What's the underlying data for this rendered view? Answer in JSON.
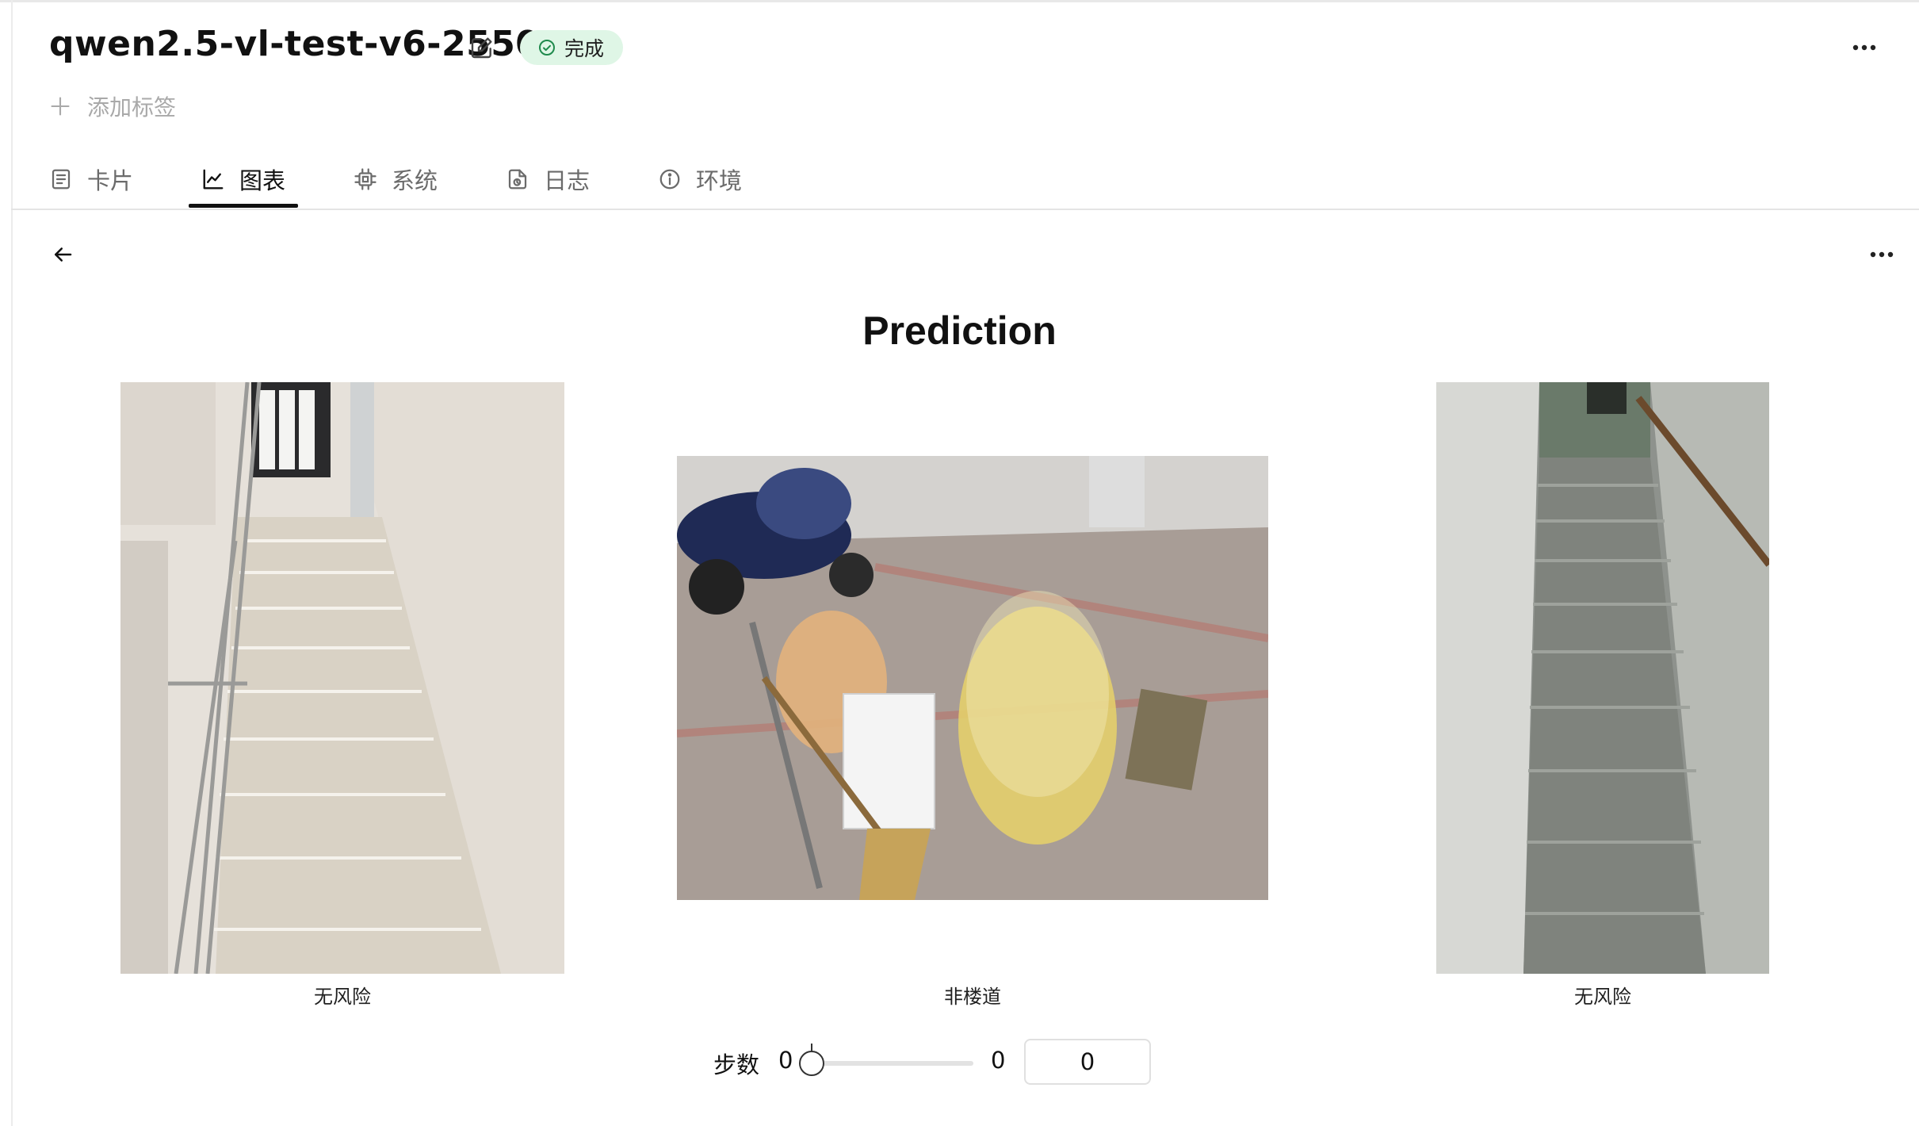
{
  "header": {
    "run_name": "qwen2.5-vl-test-v6-2550",
    "status": "完成",
    "add_tag_label": "添加标签"
  },
  "tabs": [
    {
      "label": "卡片",
      "icon": "card-icon"
    },
    {
      "label": "图表",
      "icon": "chart-line-icon",
      "active": true
    },
    {
      "label": "系统",
      "icon": "chip-icon"
    },
    {
      "label": "日志",
      "icon": "log-file-icon"
    },
    {
      "label": "环境",
      "icon": "info-icon"
    }
  ],
  "chart": {
    "title": "Prediction",
    "images": [
      {
        "caption": "无风险",
        "subject": "stairwell-with-steel-railing"
      },
      {
        "caption": "非楼道",
        "subject": "garbage-bags-and-broom-on-street"
      },
      {
        "caption": "无风险",
        "subject": "dim-concrete-stairwell"
      }
    ]
  },
  "step": {
    "label": "步数",
    "min": "0",
    "max": "0",
    "value": "0"
  },
  "colors": {
    "status_bg": "#dff6e6",
    "status_icon": "#1f8a4c",
    "active_tab": "#111111",
    "inactive_tab": "#6b6b6b"
  }
}
